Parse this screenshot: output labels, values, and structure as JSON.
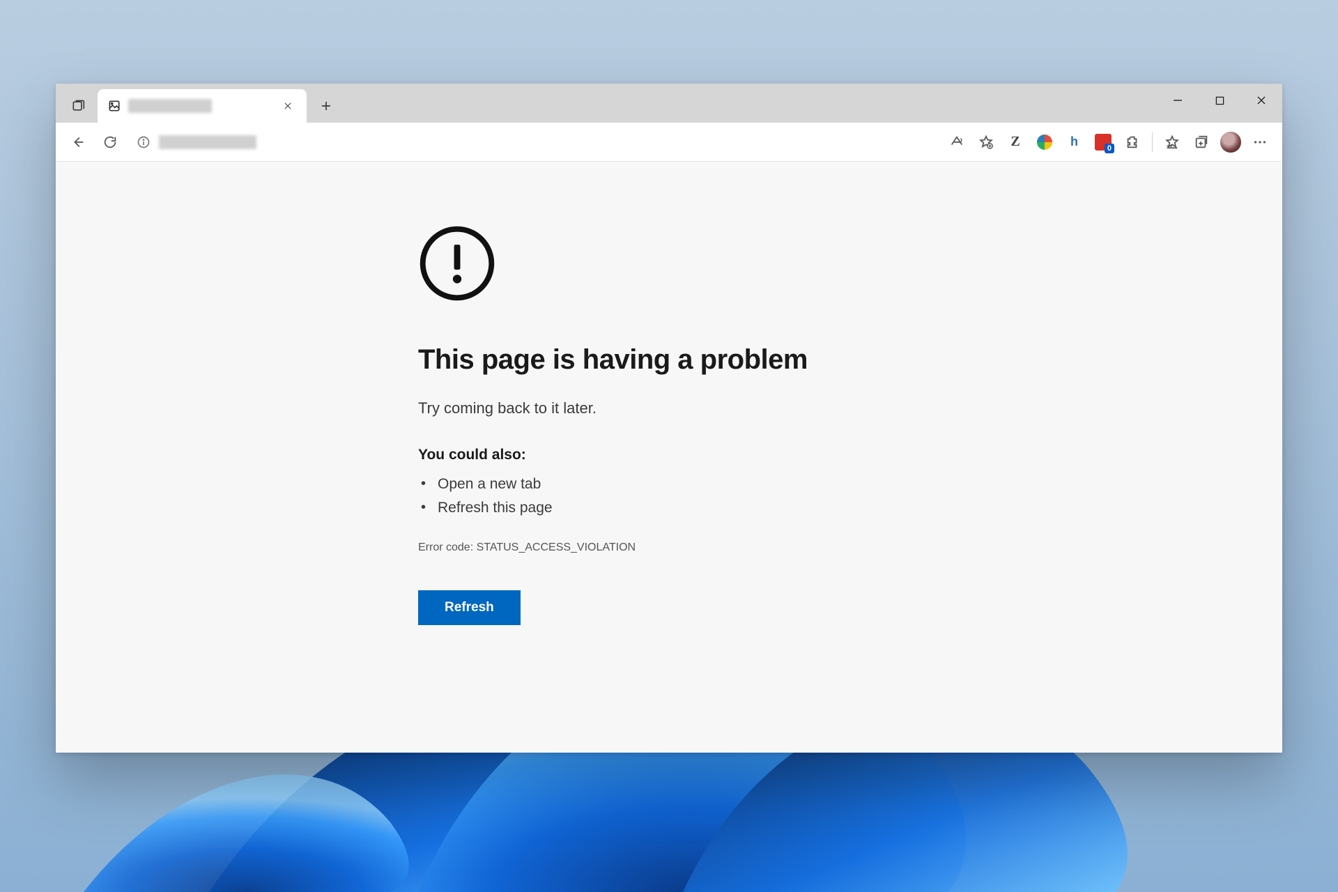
{
  "tabstrip": {
    "tab_title_redacted": true,
    "close_tooltip": "Close tab",
    "new_tab_tooltip": "New tab"
  },
  "window_controls": {
    "minimize": "Minimize",
    "maximize": "Maximize",
    "close": "Close"
  },
  "toolbar": {
    "back": "Back",
    "refresh": "Refresh",
    "address_redacted": true,
    "extensions": {
      "read_aloud": "Read aloud",
      "add_favorite": "Add this page to favorites",
      "z": "Z",
      "shield_badge": "0"
    },
    "favorites": "Favorites",
    "collections": "Collections",
    "more": "Settings and more"
  },
  "error": {
    "heading": "This page is having a problem",
    "subtext": "Try coming back to it later.",
    "also_heading": "You could also:",
    "suggestions": [
      "Open a new tab",
      "Refresh this page"
    ],
    "code_label": "Error code:",
    "code_value": "STATUS_ACCESS_VIOLATION",
    "refresh_button": "Refresh"
  },
  "colors": {
    "primary": "#0067c0"
  }
}
